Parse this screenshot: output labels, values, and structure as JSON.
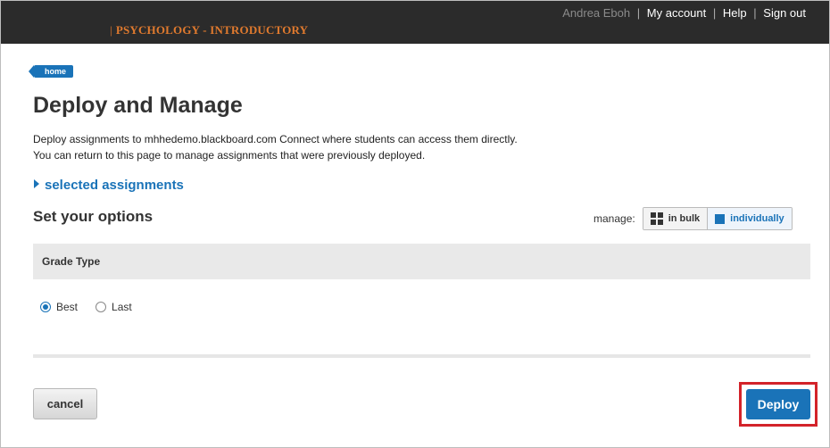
{
  "header": {
    "course_title": "PSYCHOLOGY - INTRODUCTORY",
    "user_name": "Andrea Eboh",
    "my_account": "My account",
    "help": "Help",
    "sign_out": "Sign out"
  },
  "breadcrumb": {
    "home": "home"
  },
  "page": {
    "title": "Deploy and Manage",
    "description_line1": "Deploy assignments to mhhedemo.blackboard.com Connect where students can access them directly.",
    "description_line2": "You can return to this page to manage assignments that were previously deployed.",
    "selected_assignments": "selected assignments",
    "options_heading": "Set your options"
  },
  "manage": {
    "label": "manage:",
    "in_bulk": "in bulk",
    "individually": "individually",
    "selected": "individually"
  },
  "grade_type": {
    "heading": "Grade Type",
    "options": [
      "Best",
      "Last"
    ],
    "selected": "Best"
  },
  "actions": {
    "cancel": "cancel",
    "deploy": "Deploy"
  },
  "colors": {
    "accent": "#1a73b8",
    "course_title": "#e07a2e",
    "highlight": "#d3232a"
  }
}
